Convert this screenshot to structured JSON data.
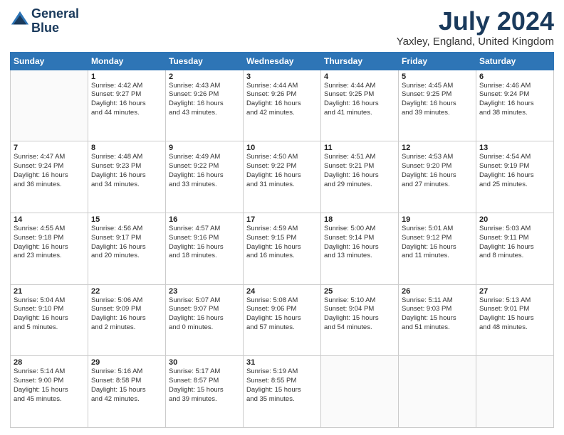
{
  "header": {
    "logo_line1": "General",
    "logo_line2": "Blue",
    "month": "July 2024",
    "location": "Yaxley, England, United Kingdom"
  },
  "days_of_week": [
    "Sunday",
    "Monday",
    "Tuesday",
    "Wednesday",
    "Thursday",
    "Friday",
    "Saturday"
  ],
  "weeks": [
    [
      {
        "day": "",
        "content": ""
      },
      {
        "day": "1",
        "content": "Sunrise: 4:42 AM\nSunset: 9:27 PM\nDaylight: 16 hours\nand 44 minutes."
      },
      {
        "day": "2",
        "content": "Sunrise: 4:43 AM\nSunset: 9:26 PM\nDaylight: 16 hours\nand 43 minutes."
      },
      {
        "day": "3",
        "content": "Sunrise: 4:44 AM\nSunset: 9:26 PM\nDaylight: 16 hours\nand 42 minutes."
      },
      {
        "day": "4",
        "content": "Sunrise: 4:44 AM\nSunset: 9:25 PM\nDaylight: 16 hours\nand 41 minutes."
      },
      {
        "day": "5",
        "content": "Sunrise: 4:45 AM\nSunset: 9:25 PM\nDaylight: 16 hours\nand 39 minutes."
      },
      {
        "day": "6",
        "content": "Sunrise: 4:46 AM\nSunset: 9:24 PM\nDaylight: 16 hours\nand 38 minutes."
      }
    ],
    [
      {
        "day": "7",
        "content": "Sunrise: 4:47 AM\nSunset: 9:24 PM\nDaylight: 16 hours\nand 36 minutes."
      },
      {
        "day": "8",
        "content": "Sunrise: 4:48 AM\nSunset: 9:23 PM\nDaylight: 16 hours\nand 34 minutes."
      },
      {
        "day": "9",
        "content": "Sunrise: 4:49 AM\nSunset: 9:22 PM\nDaylight: 16 hours\nand 33 minutes."
      },
      {
        "day": "10",
        "content": "Sunrise: 4:50 AM\nSunset: 9:22 PM\nDaylight: 16 hours\nand 31 minutes."
      },
      {
        "day": "11",
        "content": "Sunrise: 4:51 AM\nSunset: 9:21 PM\nDaylight: 16 hours\nand 29 minutes."
      },
      {
        "day": "12",
        "content": "Sunrise: 4:53 AM\nSunset: 9:20 PM\nDaylight: 16 hours\nand 27 minutes."
      },
      {
        "day": "13",
        "content": "Sunrise: 4:54 AM\nSunset: 9:19 PM\nDaylight: 16 hours\nand 25 minutes."
      }
    ],
    [
      {
        "day": "14",
        "content": "Sunrise: 4:55 AM\nSunset: 9:18 PM\nDaylight: 16 hours\nand 23 minutes."
      },
      {
        "day": "15",
        "content": "Sunrise: 4:56 AM\nSunset: 9:17 PM\nDaylight: 16 hours\nand 20 minutes."
      },
      {
        "day": "16",
        "content": "Sunrise: 4:57 AM\nSunset: 9:16 PM\nDaylight: 16 hours\nand 18 minutes."
      },
      {
        "day": "17",
        "content": "Sunrise: 4:59 AM\nSunset: 9:15 PM\nDaylight: 16 hours\nand 16 minutes."
      },
      {
        "day": "18",
        "content": "Sunrise: 5:00 AM\nSunset: 9:14 PM\nDaylight: 16 hours\nand 13 minutes."
      },
      {
        "day": "19",
        "content": "Sunrise: 5:01 AM\nSunset: 9:12 PM\nDaylight: 16 hours\nand 11 minutes."
      },
      {
        "day": "20",
        "content": "Sunrise: 5:03 AM\nSunset: 9:11 PM\nDaylight: 16 hours\nand 8 minutes."
      }
    ],
    [
      {
        "day": "21",
        "content": "Sunrise: 5:04 AM\nSunset: 9:10 PM\nDaylight: 16 hours\nand 5 minutes."
      },
      {
        "day": "22",
        "content": "Sunrise: 5:06 AM\nSunset: 9:09 PM\nDaylight: 16 hours\nand 2 minutes."
      },
      {
        "day": "23",
        "content": "Sunrise: 5:07 AM\nSunset: 9:07 PM\nDaylight: 16 hours\nand 0 minutes."
      },
      {
        "day": "24",
        "content": "Sunrise: 5:08 AM\nSunset: 9:06 PM\nDaylight: 15 hours\nand 57 minutes."
      },
      {
        "day": "25",
        "content": "Sunrise: 5:10 AM\nSunset: 9:04 PM\nDaylight: 15 hours\nand 54 minutes."
      },
      {
        "day": "26",
        "content": "Sunrise: 5:11 AM\nSunset: 9:03 PM\nDaylight: 15 hours\nand 51 minutes."
      },
      {
        "day": "27",
        "content": "Sunrise: 5:13 AM\nSunset: 9:01 PM\nDaylight: 15 hours\nand 48 minutes."
      }
    ],
    [
      {
        "day": "28",
        "content": "Sunrise: 5:14 AM\nSunset: 9:00 PM\nDaylight: 15 hours\nand 45 minutes."
      },
      {
        "day": "29",
        "content": "Sunrise: 5:16 AM\nSunset: 8:58 PM\nDaylight: 15 hours\nand 42 minutes."
      },
      {
        "day": "30",
        "content": "Sunrise: 5:17 AM\nSunset: 8:57 PM\nDaylight: 15 hours\nand 39 minutes."
      },
      {
        "day": "31",
        "content": "Sunrise: 5:19 AM\nSunset: 8:55 PM\nDaylight: 15 hours\nand 35 minutes."
      },
      {
        "day": "",
        "content": ""
      },
      {
        "day": "",
        "content": ""
      },
      {
        "day": "",
        "content": ""
      }
    ]
  ]
}
